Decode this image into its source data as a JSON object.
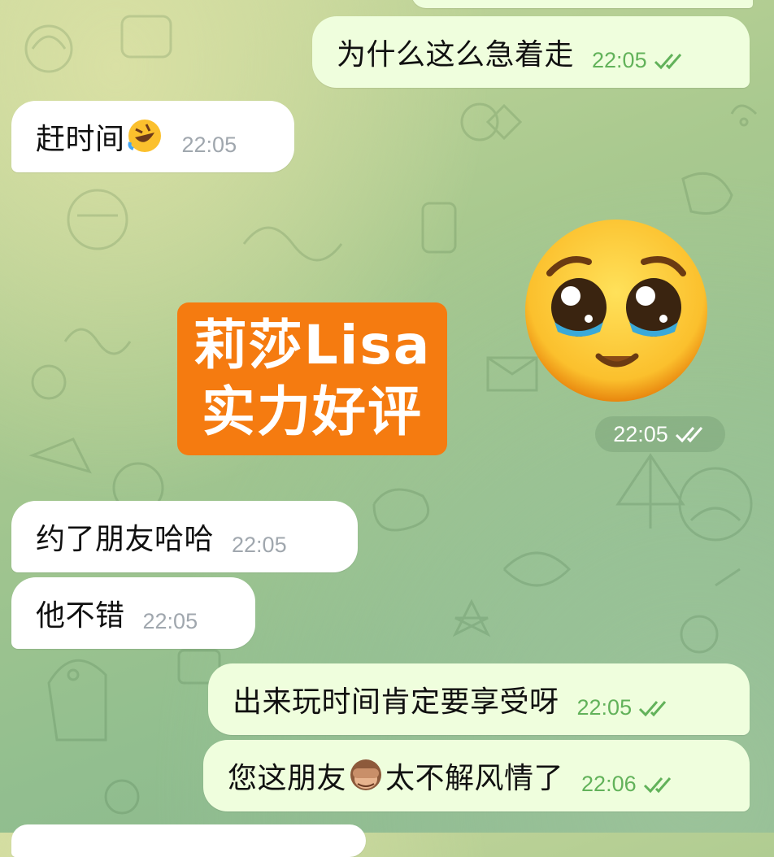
{
  "colors": {
    "incoming_bubble": "#ffffff",
    "outgoing_bubble": "#effedd",
    "outgoing_time": "#62b25a",
    "incoming_time": "#a0a7ae",
    "stamp_orange": "#f57b10"
  },
  "messages": [
    {
      "direction": "out",
      "text": "为什么这么急着走",
      "time": "22:05",
      "status": "read"
    },
    {
      "direction": "in",
      "text": "赶时间",
      "emoji": "rolling-on-floor-laughing-icon",
      "time": "22:05"
    },
    {
      "direction": "out",
      "type": "sticker",
      "sticker": "pleading-face-icon",
      "time": "22:05",
      "status": "read"
    },
    {
      "direction": "in",
      "text": "约了朋友哈哈",
      "time": "22:05"
    },
    {
      "direction": "in",
      "text": "他不错",
      "time": "22:05"
    },
    {
      "direction": "out",
      "text": "出来玩时间肯定要享受呀",
      "time": "22:05",
      "status": "read"
    },
    {
      "direction": "out",
      "text_before": "您这朋友",
      "emoji": "see-no-evil-monkey-icon",
      "text_after": "太不解风情了",
      "time": "22:06",
      "status": "read"
    }
  ],
  "watermark": {
    "line1": "莉莎Lisa",
    "line2": "实力好评"
  }
}
